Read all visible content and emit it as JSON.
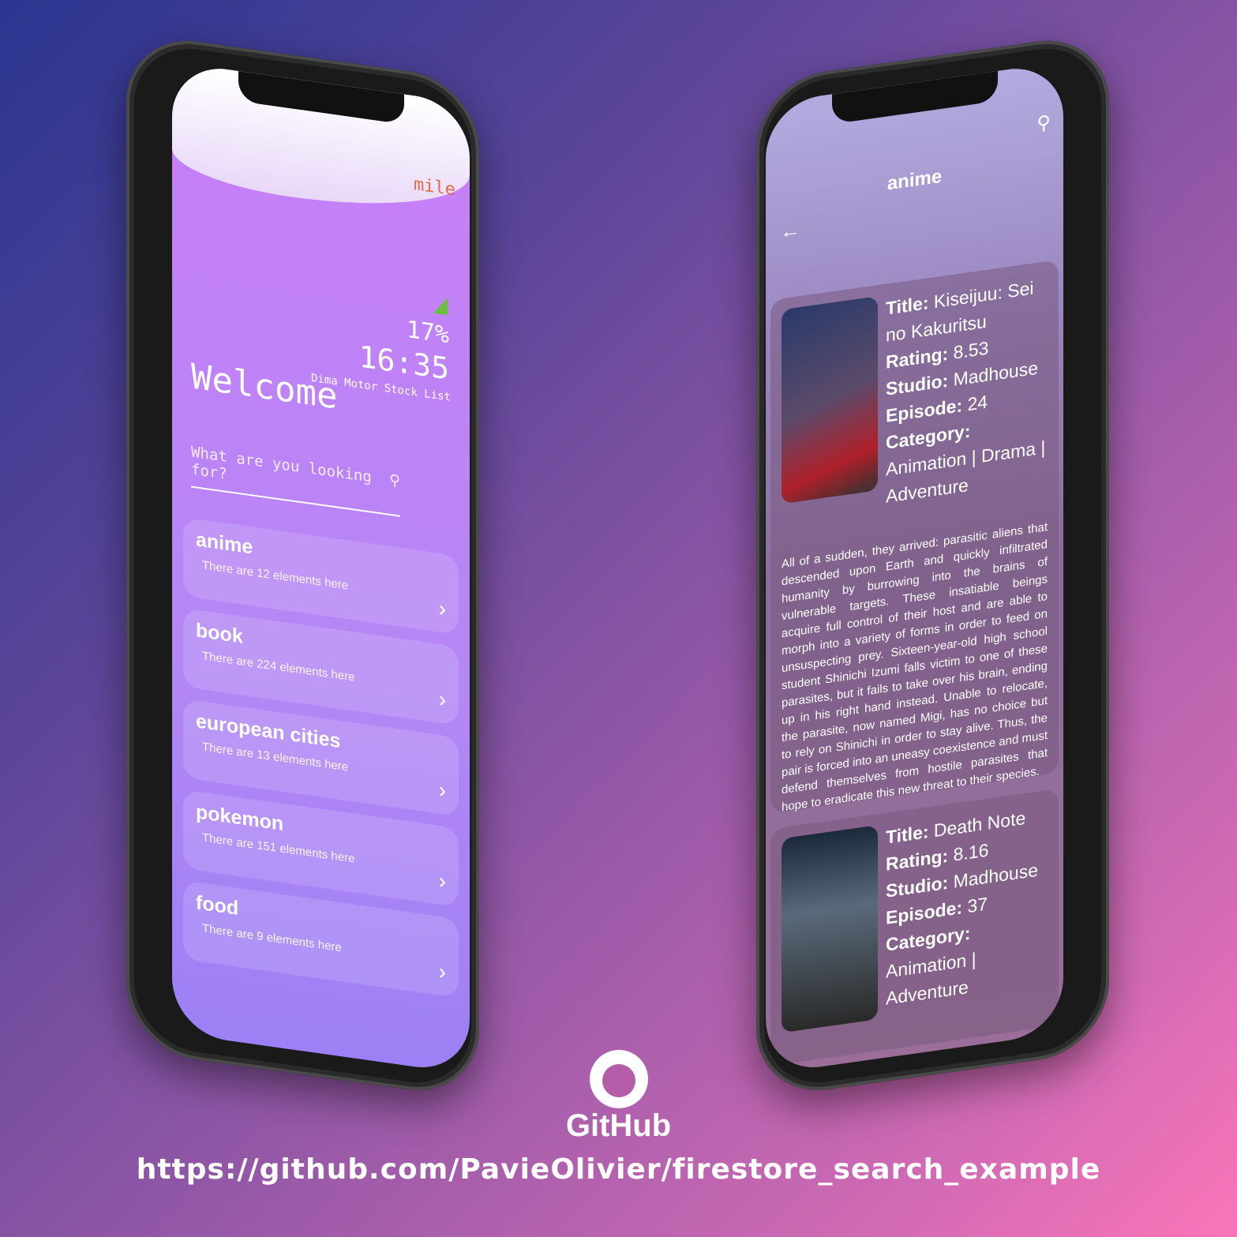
{
  "left_phone": {
    "logo": "mile",
    "battery": "17%",
    "time": "16:35",
    "subtitle": "Dima Motor Stock List",
    "welcome": "Welcome",
    "search_placeholder": "What are you looking for?",
    "categories": [
      {
        "name": "anime",
        "count": "There are 12 elements here"
      },
      {
        "name": "book",
        "count": "There are 224 elements here"
      },
      {
        "name": "european cities",
        "count": "There are 13 elements here"
      },
      {
        "name": "pokemon",
        "count": "There are 151 elements here"
      },
      {
        "name": "food",
        "count": "There are 9 elements here"
      }
    ]
  },
  "right_phone": {
    "title": "anime",
    "labels": {
      "title": "Title:",
      "rating": "Rating:",
      "studio": "Studio:",
      "episode": "Episode:",
      "category": "Category:"
    },
    "items": [
      {
        "title": "Kiseijuu: Sei no Kakuritsu",
        "rating": "8.53",
        "studio": "Madhouse",
        "episode": "24",
        "category": "Animation | Drama | Adventure",
        "description": "All of a sudden, they arrived: parasitic aliens that descended upon Earth and quickly infiltrated humanity by burrowing into the brains of vulnerable targets. These insatiable beings acquire full control of their host and are able to morph into a variety of forms in order to feed on unsuspecting prey. Sixteen-year-old high school student Shinichi Izumi falls victim to one of these parasites, but it fails to take over his brain, ending up in his right hand instead. Unable to relocate, the parasite, now named Migi, has no choice but to rely on Shinichi in order to stay alive. Thus, the pair is forced into an uneasy coexistence and must defend themselves from hostile parasites that hope to eradicate this new threat to their species."
      },
      {
        "title": "Death Note",
        "rating": "8.16",
        "studio": "Madhouse",
        "episode": "37",
        "category": "Animation | Adventure"
      }
    ]
  },
  "footer": {
    "brand": "GitHub",
    "url": "https://github.com/PavieOlivier/firestore_search_example"
  }
}
